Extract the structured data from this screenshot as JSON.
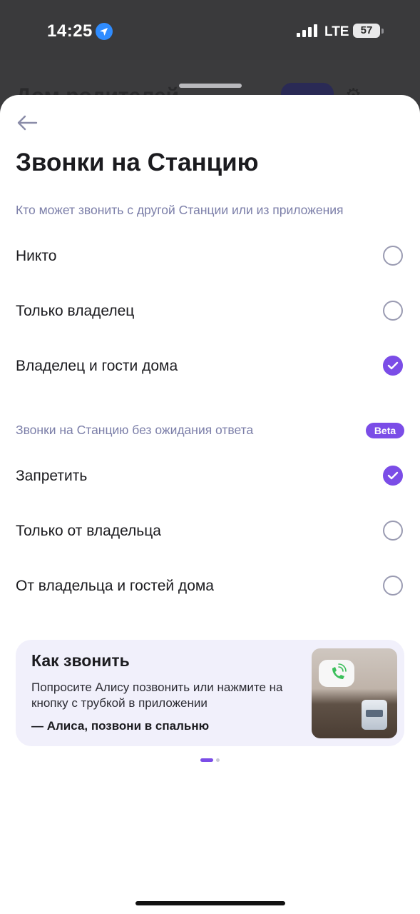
{
  "status_bar": {
    "time": "14:25",
    "network": "LTE",
    "battery": "57"
  },
  "background": {
    "title": "Дом родителей"
  },
  "header": {
    "title": "Звонки на Станцию"
  },
  "section_who": {
    "label": "Кто может звонить с другой Станции или из приложения",
    "options": [
      {
        "label": "Никто",
        "selected": false
      },
      {
        "label": "Только владелец",
        "selected": false
      },
      {
        "label": "Владелец и гости дома",
        "selected": true
      }
    ]
  },
  "section_no_answer": {
    "label": "Звонки на Станцию без ожидания ответа",
    "badge": "Beta",
    "options": [
      {
        "label": "Запретить",
        "selected": true
      },
      {
        "label": "Только от владельца",
        "selected": false
      },
      {
        "label": "От владельца и гостей дома",
        "selected": false
      }
    ]
  },
  "info_card": {
    "title": "Как звонить",
    "body": "Попросите Алису позвонить или нажмите на кнопку с трубкой в приложении",
    "example": "— Алиса, позвони в спальню"
  },
  "colors": {
    "accent": "#7b4de7",
    "muted": "#7b7ea8",
    "card_bg": "#f1f0fb"
  }
}
